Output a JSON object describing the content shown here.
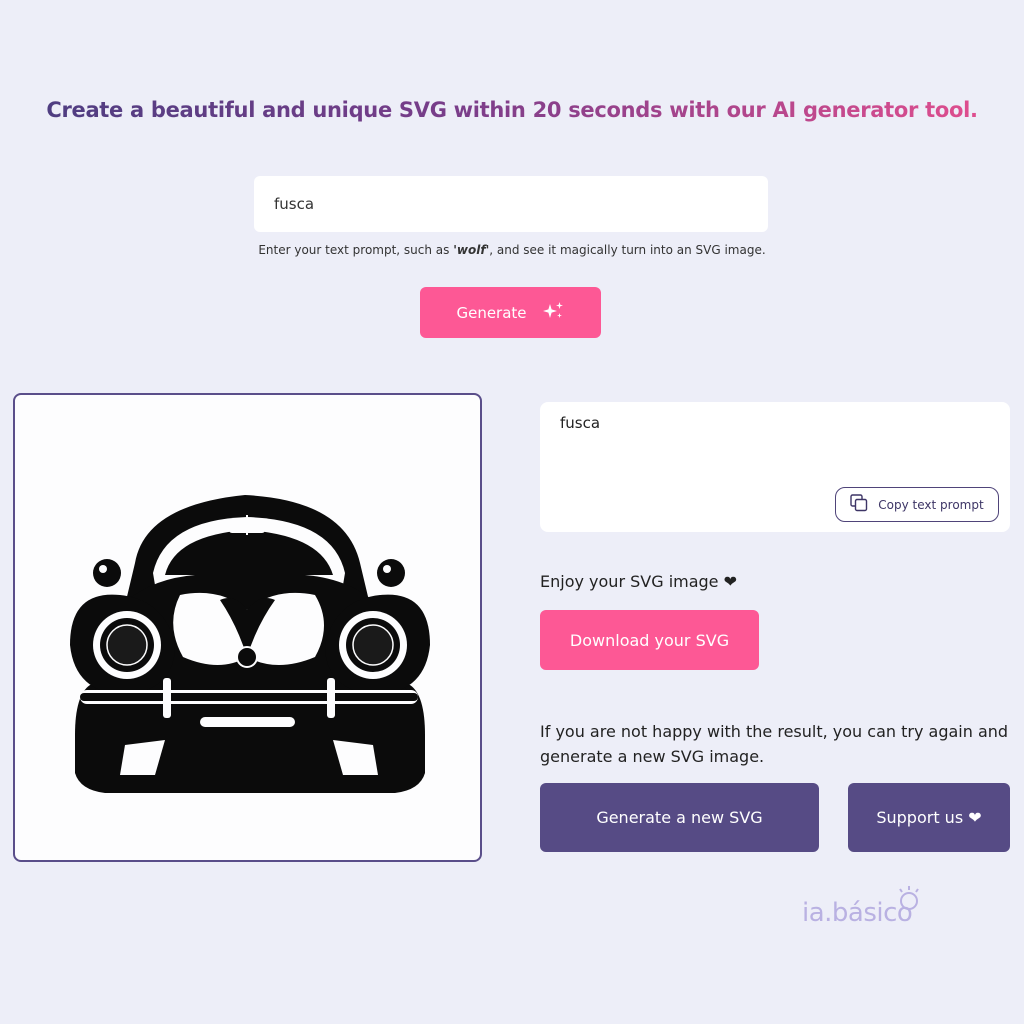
{
  "header": {
    "headline": "Create a beautiful and unique SVG within 20 seconds with our AI generator tool."
  },
  "prompt": {
    "value": "fusca",
    "hint_before": "Enter your text prompt, such as ",
    "hint_example": "'wolf'",
    "hint_after": ", and see it magically turn into an SVG image."
  },
  "generate": {
    "label": "Generate",
    "icon": "sparkles-icon"
  },
  "result": {
    "prompt_text": "fusca",
    "copy_label": "Copy text prompt",
    "copy_icon": "copy-icon",
    "enjoy_text": "Enjoy your SVG image ❤",
    "download_label": "Download your SVG",
    "retry_text": "If you are not happy with the result, you can try again and generate a new SVG image.",
    "new_svg_label": "Generate a new SVG",
    "support_label": "Support us ❤"
  },
  "brand": {
    "logo_text": "ia.básico"
  },
  "colors": {
    "background": "#edeef8",
    "pink": "#fd5895",
    "purple": "#564b85",
    "logo": "#b9b1e2"
  }
}
